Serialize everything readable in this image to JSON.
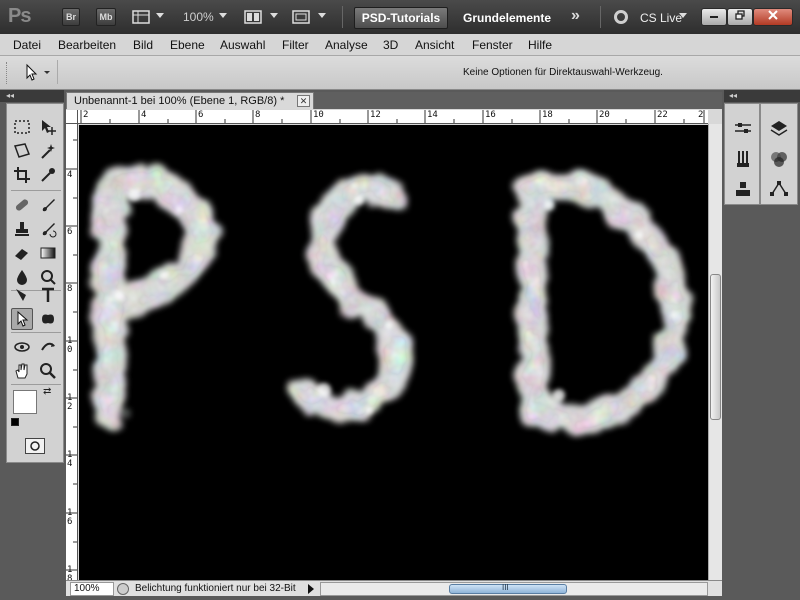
{
  "appbar": {
    "logo": "Ps",
    "br_label": "Br",
    "mb_label": "Mb",
    "zoom": "100%",
    "workspace_active": "PSD-Tutorials",
    "workspace_item": "Grundelemente",
    "more": "»",
    "cs_live": "CS Live"
  },
  "menu": [
    "Datei",
    "Bearbeiten",
    "Bild",
    "Ebene",
    "Auswahl",
    "Filter",
    "Analyse",
    "3D",
    "Ansicht",
    "Fenster",
    "Hilfe"
  ],
  "options": {
    "text": "Keine Optionen für Direktauswahl-Werkzeug."
  },
  "panel_headers": {
    "left": "◂◂",
    "doc": "◂◂",
    "right": "◂◂"
  },
  "document": {
    "title": "Unbenannt-1 bei 100% (Ebene 1, RGB/8) *",
    "close": "✕",
    "canvas_text": "PSD",
    "ruler_top": [
      "2",
      "4",
      "6",
      "8",
      "10",
      "12",
      "14",
      "16",
      "18",
      "20",
      "22",
      "2"
    ],
    "ruler_left": [
      "4",
      "6",
      "8",
      "10",
      "12",
      "14",
      "16",
      "18"
    ]
  },
  "status": {
    "zoom": "100%",
    "text": "Belichtung funktioniert nur bei 32-Bit",
    "thumb_grip": "III"
  },
  "colors": {
    "appbar": "#3a3a3a",
    "canvas": "#000000",
    "smoke": "#e8e8e8",
    "close_button": "#c0452e",
    "scroll_thumb": "#a9c7e6"
  }
}
